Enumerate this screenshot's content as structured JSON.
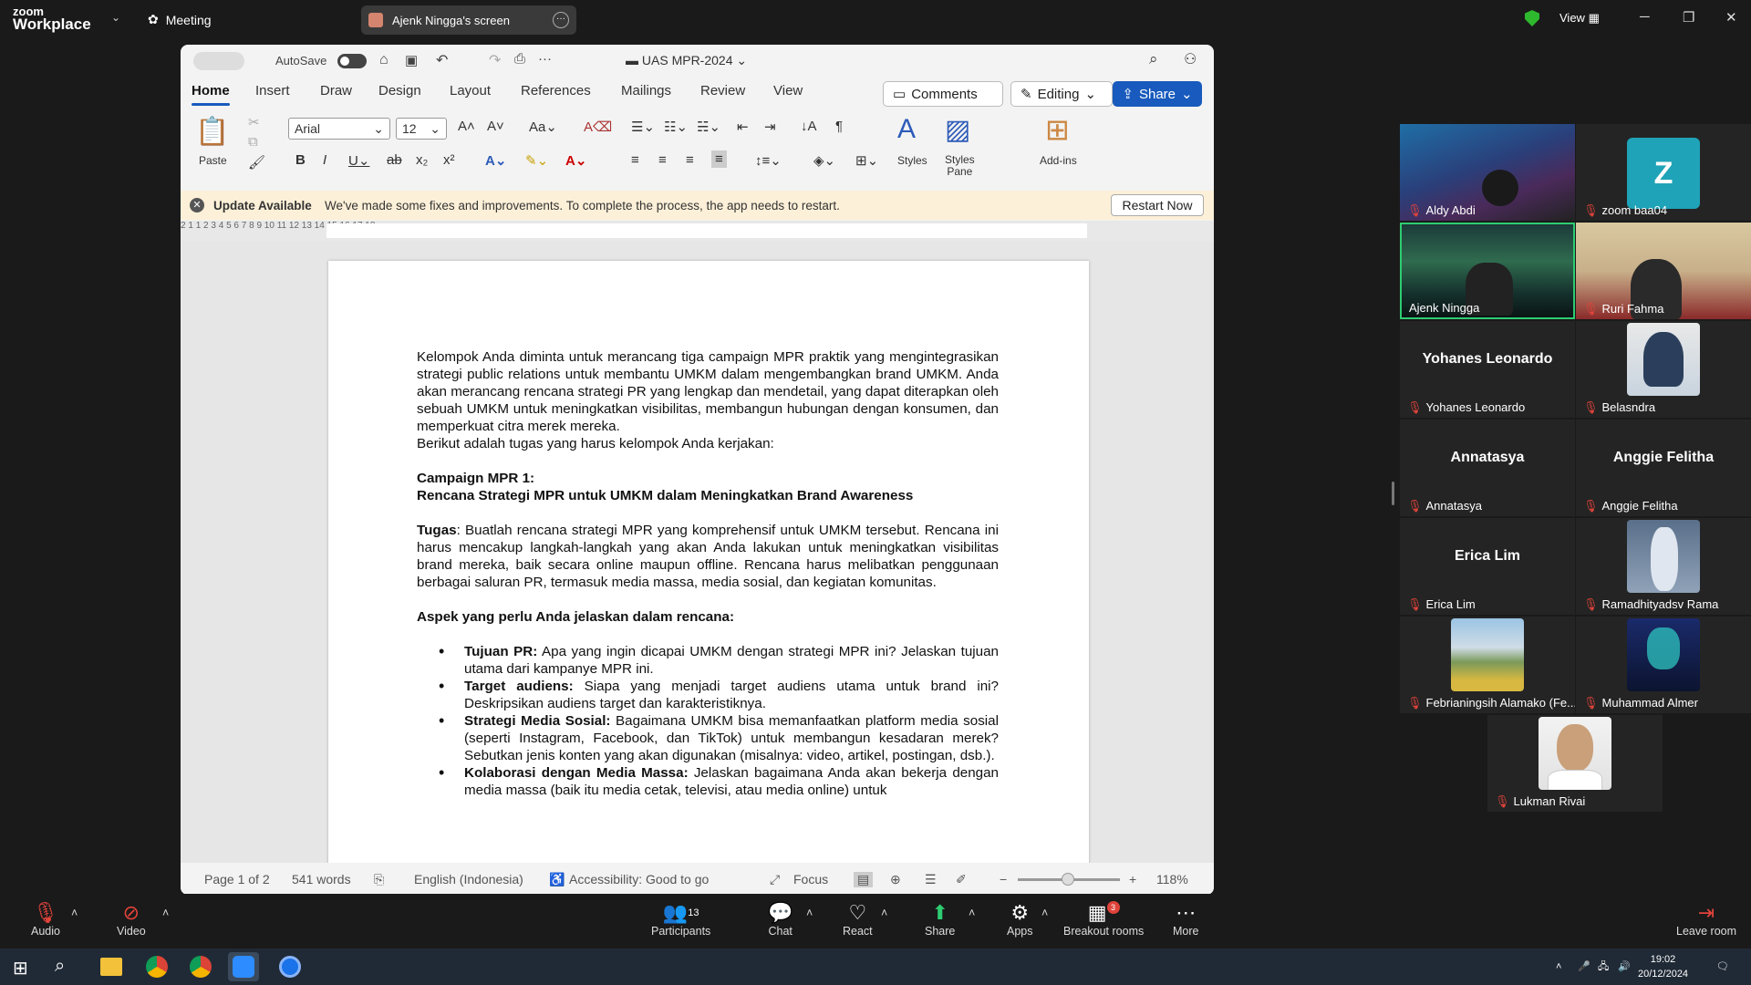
{
  "top": {
    "logo_line1": "zoom",
    "logo_line2": "Workplace",
    "meeting_label": "Meeting",
    "screen_tab": "Ajenk Ningga's screen",
    "view_label": "View"
  },
  "word": {
    "autosave": "AutoSave",
    "doc_title": "UAS MPR-2024",
    "tabs": [
      "Home",
      "Insert",
      "Draw",
      "Design",
      "Layout",
      "References",
      "Mailings",
      "Review",
      "View"
    ],
    "comments": "Comments",
    "editing": "Editing",
    "share": "Share",
    "font": "Arial",
    "size": "12",
    "paste": "Paste",
    "styles": "Styles",
    "styles_pane_1": "Styles",
    "styles_pane_2": "Pane",
    "addins": "Add-ins",
    "update_title": "Update Available",
    "update_text": "We've made some fixes and improvements. To complete the process, the app needs to restart.",
    "restart": "Restart Now",
    "ruler_ticks": [
      "2",
      "1",
      "1",
      "2",
      "3",
      "4",
      "5",
      "6",
      "7",
      "8",
      "9",
      "10",
      "11",
      "12",
      "13",
      "14",
      "15",
      "16",
      "17",
      "18"
    ],
    "status_page": "Page 1 of 2",
    "status_words": "541 words",
    "status_lang": "English (Indonesia)",
    "status_access": "Accessibility: Good to go",
    "status_focus": "Focus",
    "zoom": "118%"
  },
  "doc": {
    "p1": "Kelompok Anda diminta untuk merancang tiga campaign MPR praktik yang mengintegrasikan strategi public relations untuk membantu UMKM dalam mengembangkan brand UMKM. Anda akan merancang rencana strategi PR yang lengkap dan mendetail, yang dapat diterapkan oleh sebuah UMKM untuk meningkatkan visibilitas, membangun hubungan dengan konsumen, dan memperkuat citra merek mereka.",
    "p2": "Berikut adalah tugas yang harus kelompok Anda kerjakan:",
    "h1": "Campaign MPR 1:",
    "h2": "Rencana Strategi MPR untuk UMKM dalam Meningkatkan Brand Awareness",
    "tugas_label": "Tugas",
    "tugas_text": ": Buatlah rencana strategi MPR yang komprehensif untuk UMKM tersebut. Rencana ini harus mencakup langkah-langkah yang akan Anda lakukan untuk meningkatkan visibilitas brand mereka, baik secara online maupun offline. Rencana harus melibatkan penggunaan berbagai saluran PR, termasuk media massa, media sosial, dan kegiatan komunitas.",
    "aspek": "Aspek yang perlu Anda jelaskan dalam rencana:",
    "bullets": [
      {
        "b": "Tujuan PR:",
        "t": " Apa yang ingin dicapai UMKM dengan strategi MPR ini? Jelaskan tujuan utama dari kampanye MPR ini."
      },
      {
        "b": "Target audiens:",
        "t": " Siapa yang menjadi target audiens utama untuk brand ini? Deskripsikan audiens target dan karakteristiknya."
      },
      {
        "b": "Strategi Media Sosial:",
        "t": " Bagaimana UMKM bisa memanfaatkan platform media sosial (seperti Instagram, Facebook, dan TikTok) untuk membangun kesadaran merek? Sebutkan jenis konten yang akan digunakan (misalnya: video, artikel, postingan, dsb.)."
      },
      {
        "b": "Kolaborasi dengan Media Massa:",
        "t": " Jelaskan bagaimana Anda akan bekerja dengan media massa (baik itu media cetak, televisi, atau media online) untuk"
      }
    ]
  },
  "participants": [
    {
      "name": "Aldy Abdi",
      "type": "video"
    },
    {
      "name": "zoom baa04",
      "type": "letter",
      "letter": "Z"
    },
    {
      "name": "Ajenk Ningga",
      "type": "video"
    },
    {
      "name": "Ruri Fahma",
      "type": "video"
    },
    {
      "name": "Yohanes Leonardo",
      "type": "text"
    },
    {
      "name": "Belasndra",
      "type": "photo"
    },
    {
      "name": "Annatasya",
      "type": "text"
    },
    {
      "name": "Anggie Felitha",
      "type": "text"
    },
    {
      "name": "Erica Lim",
      "type": "text"
    },
    {
      "name": "Ramadhityadsv Rama",
      "type": "photo"
    },
    {
      "name": "Febrianingsih Alamako (Fe...",
      "type": "photo"
    },
    {
      "name": "Muhammad Almer",
      "type": "photo"
    },
    {
      "name": "Lukman Rivai",
      "type": "photo"
    }
  ],
  "bottom": {
    "audio": "Audio",
    "video": "Video",
    "participants": "Participants",
    "participants_count": "13",
    "chat": "Chat",
    "react": "React",
    "share": "Share",
    "apps": "Apps",
    "breakout": "Breakout rooms",
    "breakout_badge": "3",
    "more": "More",
    "leave": "Leave room"
  },
  "taskbar": {
    "time": "19:02",
    "date": "20/12/2024"
  },
  "colors": {
    "accent": "#185abd",
    "zoom_bg": "#1a1a1a",
    "active_speaker": "#2ecc71"
  }
}
